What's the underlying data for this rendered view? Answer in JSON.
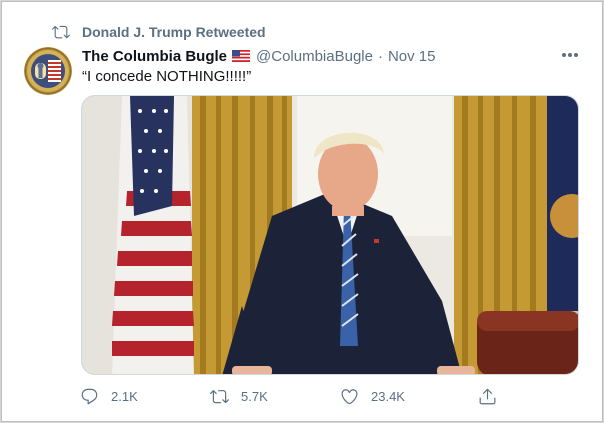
{
  "retweet": {
    "label": "Donald J. Trump Retweeted",
    "icon": "retweet-icon"
  },
  "tweet": {
    "author_name": "The Columbia Bugle",
    "flag_icon": "us-flag-emoji",
    "handle": "@ColumbiaBugle",
    "separator": "·",
    "date": "Nov 15",
    "text": "“I concede NOTHING!!!!!”",
    "more_icon": "more-options-icon"
  },
  "actions": {
    "reply_count": "2.1K",
    "retweet_count": "5.7K",
    "like_count": "23.4K",
    "share_icon": "share-icon"
  },
  "colors": {
    "secondary_text": "#5b7083",
    "primary_text": "#0f1419"
  }
}
